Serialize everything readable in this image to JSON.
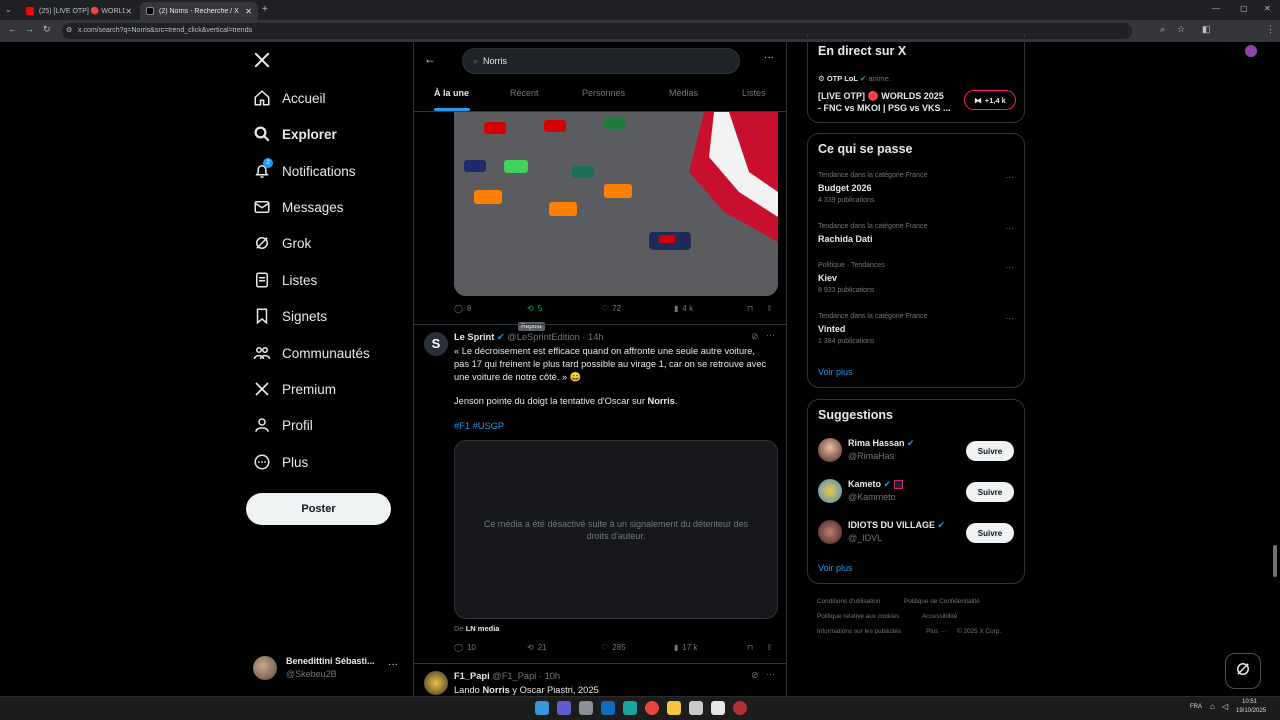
{
  "browser": {
    "tabs": [
      {
        "label": "(25) [LIVE OTP] 🔴 WORLDS 2025",
        "active": false
      },
      {
        "label": "(2) Norris - Recherche / X",
        "active": true
      }
    ],
    "url": "x.com/search?q=Norris&src=trend_click&vertical=trends"
  },
  "nav": {
    "items": [
      {
        "label": "Accueil",
        "icon": "home-icon"
      },
      {
        "label": "Explorer",
        "icon": "search-icon"
      },
      {
        "label": "Notifications",
        "icon": "bell-icon",
        "badge": "2"
      },
      {
        "label": "Messages",
        "icon": "mail-icon"
      },
      {
        "label": "Grok",
        "icon": "grok-icon"
      },
      {
        "label": "Listes",
        "icon": "list-icon"
      },
      {
        "label": "Signets",
        "icon": "bookmark-icon"
      },
      {
        "label": "Communautés",
        "icon": "communities-icon"
      },
      {
        "label": "Premium",
        "icon": "x-logo-icon"
      },
      {
        "label": "Profil",
        "icon": "profile-icon"
      },
      {
        "label": "Plus",
        "icon": "more-circle-icon"
      }
    ],
    "post_label": "Poster",
    "account_name": "Benedittini Sébasti...",
    "account_handle": "@Skebeu2B"
  },
  "search": {
    "query": "Norris",
    "tabs": [
      "À la une",
      "Récent",
      "Personnes",
      "Médias",
      "Listes"
    ]
  },
  "tweet1_actions": {
    "replies": "8",
    "reposts": "5",
    "likes": "72",
    "views": "4 k",
    "tooltip": "Repost"
  },
  "tweet2": {
    "name": "Le Sprint",
    "handle": "@LeSprintEdition · 14h",
    "line1": "« Le décroisement est efficace quand on affronte une seule autre voiture,",
    "line2": "pas 17 qui freinent le plus tard possible au virage 1, car on se retrouve avec",
    "line3": "une voiture de notre côté. » 😄",
    "line4_prefix": "Jenson pointe du doigt la tentative d'Oscar sur ",
    "line4_bold": "Norris",
    "line4_suffix": ".",
    "hashtags": "#F1 #USGP",
    "media_notice": "Ce média a été désactivé suite à un signalement du détenteur des droits d'auteur.",
    "source_prefix": "De",
    "source_name": "LN media",
    "replies": "10",
    "reposts": "21",
    "likes": "285",
    "views": "17 k"
  },
  "tweet3": {
    "name": "F1_Papi",
    "handle": "@F1_Papi · 10h",
    "line1_prefix": "Lando ",
    "line1_bold": "Norris",
    "line1_suffix": " y Oscar Piastri, 2025"
  },
  "live": {
    "title": "En direct sur X",
    "host": "OTP LoL",
    "host_suffix": "anime.",
    "stream_line1": "[LIVE OTP] 🔴 WORLDS 2025",
    "stream_line2": "- FNC vs MKOI | PSG vs VKS ...",
    "viewers": "+1,4 k"
  },
  "trends": {
    "title": "Ce qui se passe",
    "items": [
      {
        "category": "Tendance dans la catégorie France",
        "name": "Budget 2026",
        "count": "4 339 publications"
      },
      {
        "category": "Tendance dans la catégorie France",
        "name": "Rachida Dati",
        "count": ""
      },
      {
        "category": "Politique · Tendances",
        "name": "Kiev",
        "count": "8 933 publications"
      },
      {
        "category": "Tendance dans la catégorie France",
        "name": "Vinted",
        "count": "1 384 publications"
      }
    ],
    "see_more": "Voir plus"
  },
  "suggestions": {
    "title": "Suggestions",
    "items": [
      {
        "name": "Rima Hassan",
        "handle": "@RimaHas",
        "follow": "Suivre"
      },
      {
        "name": "Kameto",
        "handle": "@Kammeto",
        "follow": "Suivre"
      },
      {
        "name": "IDIOTS DU VILLAGE",
        "handle": "@_IDVL",
        "follow": "Suivre"
      }
    ],
    "see_more": "Voir plus"
  },
  "footer": {
    "links": [
      "Conditions d'utilisation",
      "Politique de Confidentialité",
      "Politique relative aux cookies",
      "Accessibilité",
      "Informations sur les publicités",
      "Plus ···",
      "© 2025 X Corp."
    ]
  },
  "taskbar": {
    "lang": "FRA",
    "time": "10:51",
    "date": "19/10/2025"
  },
  "colors": {
    "accent": "#1d9bf0",
    "repost_green": "#00ba7c",
    "live_red": "#f91880"
  }
}
